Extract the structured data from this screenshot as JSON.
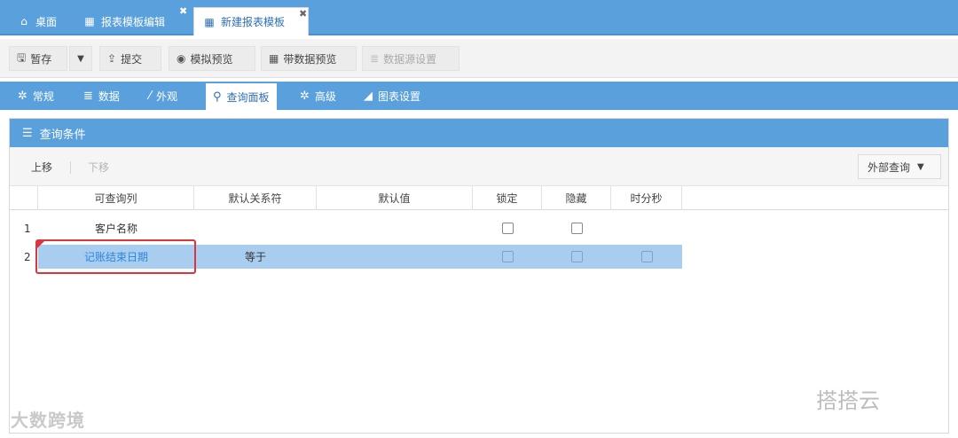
{
  "top_tabs": [
    {
      "label": "桌面",
      "icon": "home-icon",
      "active": false
    },
    {
      "label": "报表模板编辑",
      "icon": "table-icon",
      "active": false,
      "closable": true
    },
    {
      "label": "新建报表模板",
      "icon": "table-icon",
      "active": true,
      "closable": true
    }
  ],
  "toolbar": {
    "save": "暂存",
    "submit": "提交",
    "sim_preview": "模拟预览",
    "data_preview": "带数据预览",
    "datasource": "数据源设置"
  },
  "sub_tabs": [
    {
      "label": "常规",
      "icon": "gear-icon"
    },
    {
      "label": "数据",
      "icon": "database-icon"
    },
    {
      "label": "外观",
      "icon": "magic-wand-icon"
    },
    {
      "label": "查询面板",
      "icon": "search-icon",
      "active": true
    },
    {
      "label": "高级",
      "icon": "gears-icon"
    },
    {
      "label": "图表设置",
      "icon": "area-chart-icon"
    }
  ],
  "panel": {
    "title": "查询条件",
    "move_up": "上移",
    "move_down": "下移",
    "external_query": "外部查询"
  },
  "grid": {
    "headers": [
      "可查询列",
      "默认关系符",
      "默认值",
      "锁定",
      "隐藏",
      "时分秒"
    ],
    "rows": [
      {
        "num": "1",
        "column": "客户名称",
        "relation": "",
        "default": "",
        "locked": false,
        "hidden": false
      },
      {
        "num": "2",
        "column": "记账结束日期",
        "relation": "等于",
        "default": "",
        "locked": false,
        "hidden": false,
        "hms": false
      }
    ]
  },
  "watermarks": {
    "left": "大数跨境",
    "right": "搭搭云"
  },
  "colors": {
    "accent": "#5aa0dc",
    "selection": "#a9cdee",
    "highlight_box": "#d9363e"
  }
}
